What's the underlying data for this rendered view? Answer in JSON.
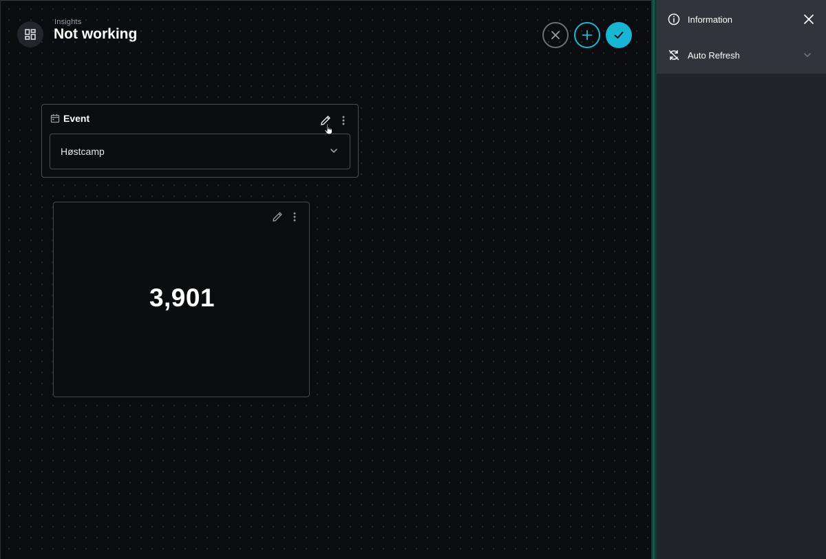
{
  "header": {
    "breadcrumb": "Insights",
    "title": "Not working",
    "icon": "dashboard-grid-icon",
    "actions": {
      "cancel_icon": "close-icon",
      "add_icon": "plus-icon",
      "confirm_icon": "check-icon"
    }
  },
  "filter_card": {
    "title": "Event",
    "icon": "calendar-icon",
    "select_value": "Høstcamp",
    "edit_icon": "pencil-icon",
    "menu_icon": "more-vertical-icon"
  },
  "kpi_card": {
    "value": "3,901",
    "edit_icon": "pencil-icon",
    "menu_icon": "more-vertical-icon"
  },
  "side_panel": {
    "info_label": "Information",
    "info_icon": "info-circle-icon",
    "close_icon": "close-icon",
    "refresh_label": "Auto Refresh",
    "refresh_icon": "sync-off-icon",
    "chevron_icon": "chevron-down-icon"
  },
  "colors": {
    "background": "#0b0c10",
    "accent": "#19b6d3",
    "panel": "#212429",
    "panel_header": "#31353b",
    "divider_accent": "#12594b"
  }
}
